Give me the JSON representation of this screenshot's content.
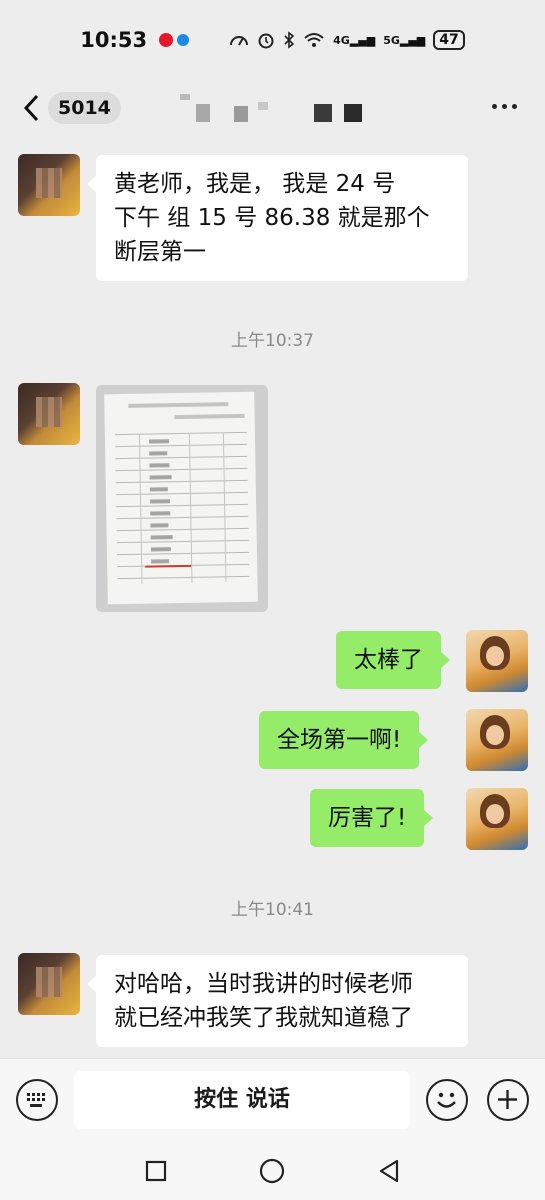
{
  "status_bar": {
    "time": "10:53",
    "signal_4g": "4G",
    "signal_5g": "5G",
    "battery": "47"
  },
  "header": {
    "unread_count": "5014"
  },
  "messages": [
    {
      "side": "left",
      "type": "text",
      "text_line1": "黄老师，我是，  我是 24 号",
      "text_line2": "下午  组 15 号 86.38 就是那个",
      "text_line3": "断层第一"
    },
    {
      "type": "timestamp",
      "text": "上午10:37"
    },
    {
      "side": "left",
      "type": "image"
    },
    {
      "side": "right",
      "type": "text",
      "text": "太棒了"
    },
    {
      "side": "right",
      "type": "text",
      "text": "全场第一啊!"
    },
    {
      "side": "right",
      "type": "text",
      "text": "厉害了!"
    },
    {
      "type": "timestamp",
      "text": "上午10:41"
    },
    {
      "side": "left",
      "type": "text",
      "text_line1": "对哈哈，当时我讲的时候老师",
      "text_line2": "就已经冲我笑了我就知道稳了"
    }
  ],
  "input_bar": {
    "voice_label": "按住 说话"
  },
  "colors": {
    "background": "#ededed",
    "sent_bubble": "#95ec69",
    "received_bubble": "#ffffff"
  }
}
